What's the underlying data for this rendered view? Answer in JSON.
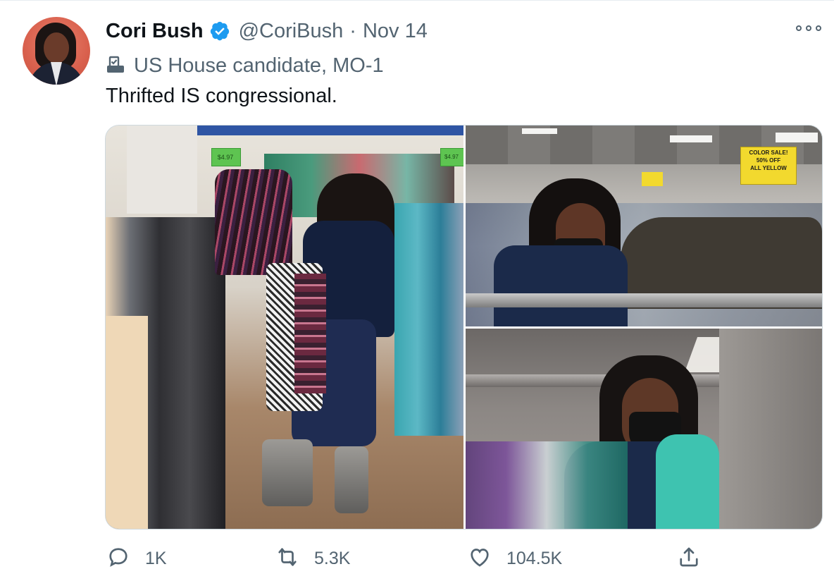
{
  "tweet": {
    "author_name": "Cori Bush",
    "handle": "@CoriBush",
    "separator": "·",
    "date": "Nov 14",
    "label": "US House candidate, MO-1",
    "text": "Thrifted IS congressional.",
    "media": {
      "photo1_sign_left": "$4.97",
      "photo1_sign_right": "$4.97",
      "photo2_sign": "COLOR SALE! 50% OFF ALL YELLOW",
      "photo2_sign_line1": "COLOR SALE!",
      "photo2_sign_line2": "50% OFF",
      "photo2_sign_line3": "ALL YELLOW"
    }
  },
  "actions": {
    "reply_count": "1K",
    "retweet_count": "5.3K",
    "like_count": "104.5K"
  },
  "icons": {
    "verified": "verified-badge-icon",
    "label": "ballot-box-icon",
    "more": "more-options-icon",
    "reply": "reply-icon",
    "retweet": "retweet-icon",
    "like": "heart-icon",
    "share": "share-icon"
  },
  "colors": {
    "verified_blue": "#1d9bf0",
    "secondary_text": "#536471",
    "primary_text": "#0f1419"
  }
}
